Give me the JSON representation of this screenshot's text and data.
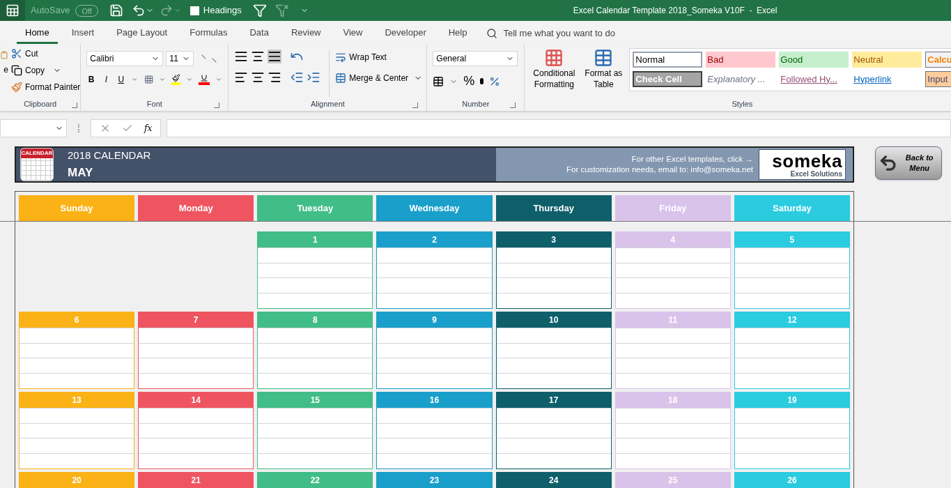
{
  "title_bar": {
    "autosave_label": "AutoSave",
    "autosave_state": "Off",
    "autosave_on": false,
    "headings_label": "Headings",
    "headings_checked": false,
    "title": "Excel Calendar Template 2018_Someka V10F  -  Excel"
  },
  "ribbon_tabs": [
    {
      "label": "Home",
      "selected": true
    },
    {
      "label": "Insert",
      "selected": false
    },
    {
      "label": "Page Layout",
      "selected": false
    },
    {
      "label": "Formulas",
      "selected": false
    },
    {
      "label": "Data",
      "selected": false
    },
    {
      "label": "Review",
      "selected": false
    },
    {
      "label": "View",
      "selected": false
    },
    {
      "label": "Developer",
      "selected": false
    },
    {
      "label": "Help",
      "selected": false
    }
  ],
  "tell_me": "Tell me what you want to do",
  "clipboard": {
    "paste_label": "e",
    "cut": "Cut",
    "copy": "Copy",
    "format_painter": "Format Painter",
    "group": "Clipboard"
  },
  "font": {
    "name": "Calibri",
    "size": "11",
    "bold": "B",
    "italic": "I",
    "underline": "U",
    "group": "Font"
  },
  "alignment": {
    "wrap": "Wrap Text",
    "merge": "Merge & Center",
    "group": "Alignment"
  },
  "number": {
    "format": "General",
    "percent": "%",
    "group": "Number"
  },
  "styles": {
    "conditional": "Conditional Formatting",
    "format_table": "Format as Table",
    "group": "Styles",
    "cells": [
      {
        "label": "Normal",
        "kind": "normal"
      },
      {
        "label": "Bad",
        "kind": "bad"
      },
      {
        "label": "Good",
        "kind": "good"
      },
      {
        "label": "Neutral",
        "kind": "neutral"
      },
      {
        "label": "Calcu",
        "kind": "calc"
      },
      {
        "label": "Check Cell",
        "kind": "check"
      },
      {
        "label": "Explanatory ...",
        "kind": "explanatory"
      },
      {
        "label": "Followed Hy...",
        "kind": "followed"
      },
      {
        "label": "Hyperlink",
        "kind": "hyperlink"
      },
      {
        "label": "Input",
        "kind": "input"
      }
    ]
  },
  "formula_bar": {
    "fx": "fx"
  },
  "calendar": {
    "year_title": "2018 CALENDAR",
    "month": "MAY",
    "icon_label": "CALENDAR",
    "link_line": "For other Excel templates, click →",
    "email_line": "For customization needs, email to: info@someka.net",
    "logo": "someka",
    "logo_sub": "Excel Solutions",
    "back_button": "Back to Menu",
    "weekdays": [
      {
        "label": "Sunday",
        "color": "#fbb216"
      },
      {
        "label": "Monday",
        "color": "#ee5561"
      },
      {
        "label": "Tuesday",
        "color": "#41bd87"
      },
      {
        "label": "Wednesday",
        "color": "#1a9fca"
      },
      {
        "label": "Thursday",
        "color": "#0f5f6b"
      },
      {
        "label": "Friday",
        "color": "#d9c3eb"
      },
      {
        "label": "Saturday",
        "color": "#2bcbe0"
      }
    ],
    "weeks": [
      [
        {
          "kind": "blank"
        },
        {
          "kind": "blank"
        },
        {
          "kind": "day",
          "day": "1"
        },
        {
          "kind": "day",
          "day": "2"
        },
        {
          "kind": "day",
          "day": "3"
        },
        {
          "kind": "day",
          "day": "4"
        },
        {
          "kind": "day",
          "day": "5"
        }
      ],
      [
        {
          "kind": "day",
          "day": "6"
        },
        {
          "kind": "day",
          "day": "7"
        },
        {
          "kind": "day",
          "day": "8"
        },
        {
          "kind": "day",
          "day": "9"
        },
        {
          "kind": "day",
          "day": "10"
        },
        {
          "kind": "day",
          "day": "11"
        },
        {
          "kind": "day",
          "day": "12"
        }
      ],
      [
        {
          "kind": "day",
          "day": "13"
        },
        {
          "kind": "day",
          "day": "14"
        },
        {
          "kind": "day",
          "day": "15"
        },
        {
          "kind": "day",
          "day": "16"
        },
        {
          "kind": "day",
          "day": "17"
        },
        {
          "kind": "day",
          "day": "18"
        },
        {
          "kind": "day",
          "day": "19"
        }
      ],
      [
        {
          "kind": "day",
          "day": "20"
        },
        {
          "kind": "day",
          "day": "21"
        },
        {
          "kind": "day",
          "day": "22"
        },
        {
          "kind": "day",
          "day": "23"
        },
        {
          "kind": "day",
          "day": "24"
        },
        {
          "kind": "day",
          "day": "25"
        },
        {
          "kind": "day",
          "day": "26"
        }
      ]
    ]
  }
}
